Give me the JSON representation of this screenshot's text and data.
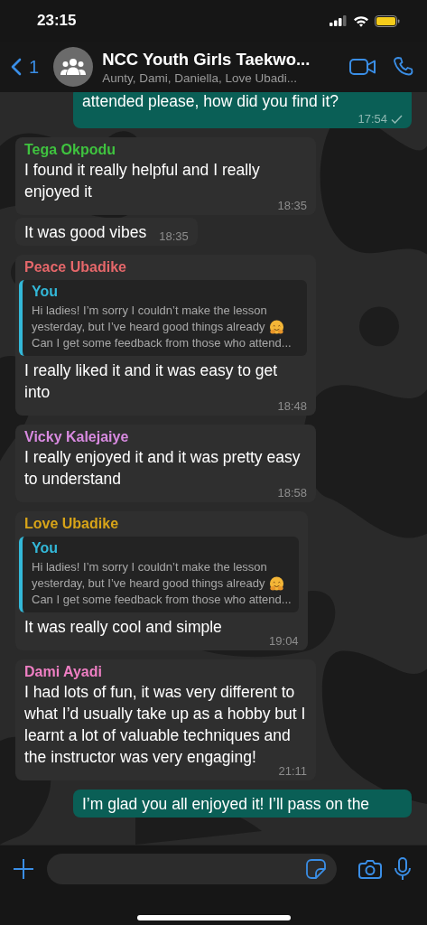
{
  "status_bar": {
    "time": "23:15"
  },
  "header": {
    "back_count": "1",
    "title": "NCC Youth Girls Taekwo...",
    "subtitle": "Aunty, Dami, Daniella, Love Ubadi..."
  },
  "messages": [
    {
      "kind": "outgoing",
      "text": "attended please, how did you find it?",
      "time": "17:54",
      "sent": true
    },
    {
      "kind": "incoming",
      "sender": "Tega Okpodu",
      "color": "#3fc33f",
      "text": "I found it really helpful and I really enjoyed it",
      "time": "18:35"
    },
    {
      "kind": "incoming",
      "text": "It was good vibes",
      "time": "18:35"
    },
    {
      "kind": "incoming",
      "sender": "Peace Ubadike",
      "color": "#e5676a",
      "quote": {
        "author": "You",
        "lines": [
          {
            "text": "Hi ladies! I’m sorry I couldn’t make the lesson",
            "emoji": false
          },
          {
            "text": "yesterday, but I’ve heard good things already",
            "emoji": true
          },
          {
            "text": "Can I get some feedback from those who attend...",
            "emoji": false
          }
        ]
      },
      "text": "I really liked it and it was easy to get into",
      "time": "18:48"
    },
    {
      "kind": "incoming",
      "sender": "Vicky Kalejaiye",
      "color": "#d88ae0",
      "text": "I really enjoyed it and it was pretty easy to understand",
      "time": "18:58"
    },
    {
      "kind": "incoming",
      "sender": "Love Ubadike",
      "color": "#d8a418",
      "quote": {
        "author": "You",
        "lines": [
          {
            "text": "Hi ladies! I’m sorry I couldn’t make the lesson",
            "emoji": false
          },
          {
            "text": "yesterday, but I’ve heard good things already",
            "emoji": true
          },
          {
            "text": "Can I get some feedback from those who attend...",
            "emoji": false
          }
        ]
      },
      "text": "It was really cool and simple",
      "time": "19:04"
    },
    {
      "kind": "incoming",
      "sender": "Dami Ayadi",
      "color": "#ef7fc4",
      "text": "I had lots of fun, it was very different to what I’d usually take up as a hobby but I learnt a lot of valuable techniques and the instructor was very engaging!",
      "time": "21:11"
    },
    {
      "kind": "outgoing",
      "text": "I’m glad you all enjoyed it! I’ll pass on the"
    }
  ]
}
